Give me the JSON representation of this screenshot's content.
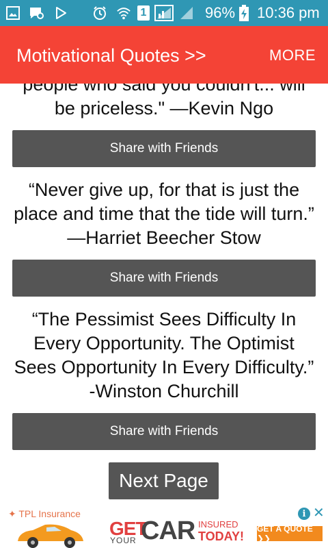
{
  "status_bar": {
    "battery_text": "96%",
    "time": "10:36 pm",
    "sim_slot": "1",
    "icons": [
      "gallery-icon",
      "chat-notification-icon",
      "play-store-icon",
      "alarm-icon",
      "wifi-icon",
      "sim-signal-icon",
      "signal-icon",
      "battery-charging-icon"
    ]
  },
  "app_bar": {
    "title": "Motivational Quotes >>",
    "more_label": "MORE",
    "color": "#f44336"
  },
  "quotes": [
    {
      "text": "people who said you couldn't... will be priceless.\" —Kevin Ngo",
      "share_label": "Share with Friends"
    },
    {
      "text": "“Never give up, for that is just the place and time that the tide will turn.” —Harriet Beecher Stow",
      "share_label": "Share with Friends"
    },
    {
      "text": "“The Pessimist Sees Difficulty In Every Opportunity. The Optimist Sees Opportunity In Every Difficulty.” -Winston Churchill",
      "share_label": "Share with Friends"
    }
  ],
  "next_page_label": "Next Page",
  "ad": {
    "brand": "TPL Insurance",
    "headline_get": "GET",
    "headline_your": "YOUR",
    "headline_car": "CAR",
    "headline_insured": "INSURED",
    "headline_today": "TODAY!",
    "cta_label": "GET A QUOTE ❯❯",
    "info_icon": "info-icon",
    "close_icon": "close-icon"
  }
}
